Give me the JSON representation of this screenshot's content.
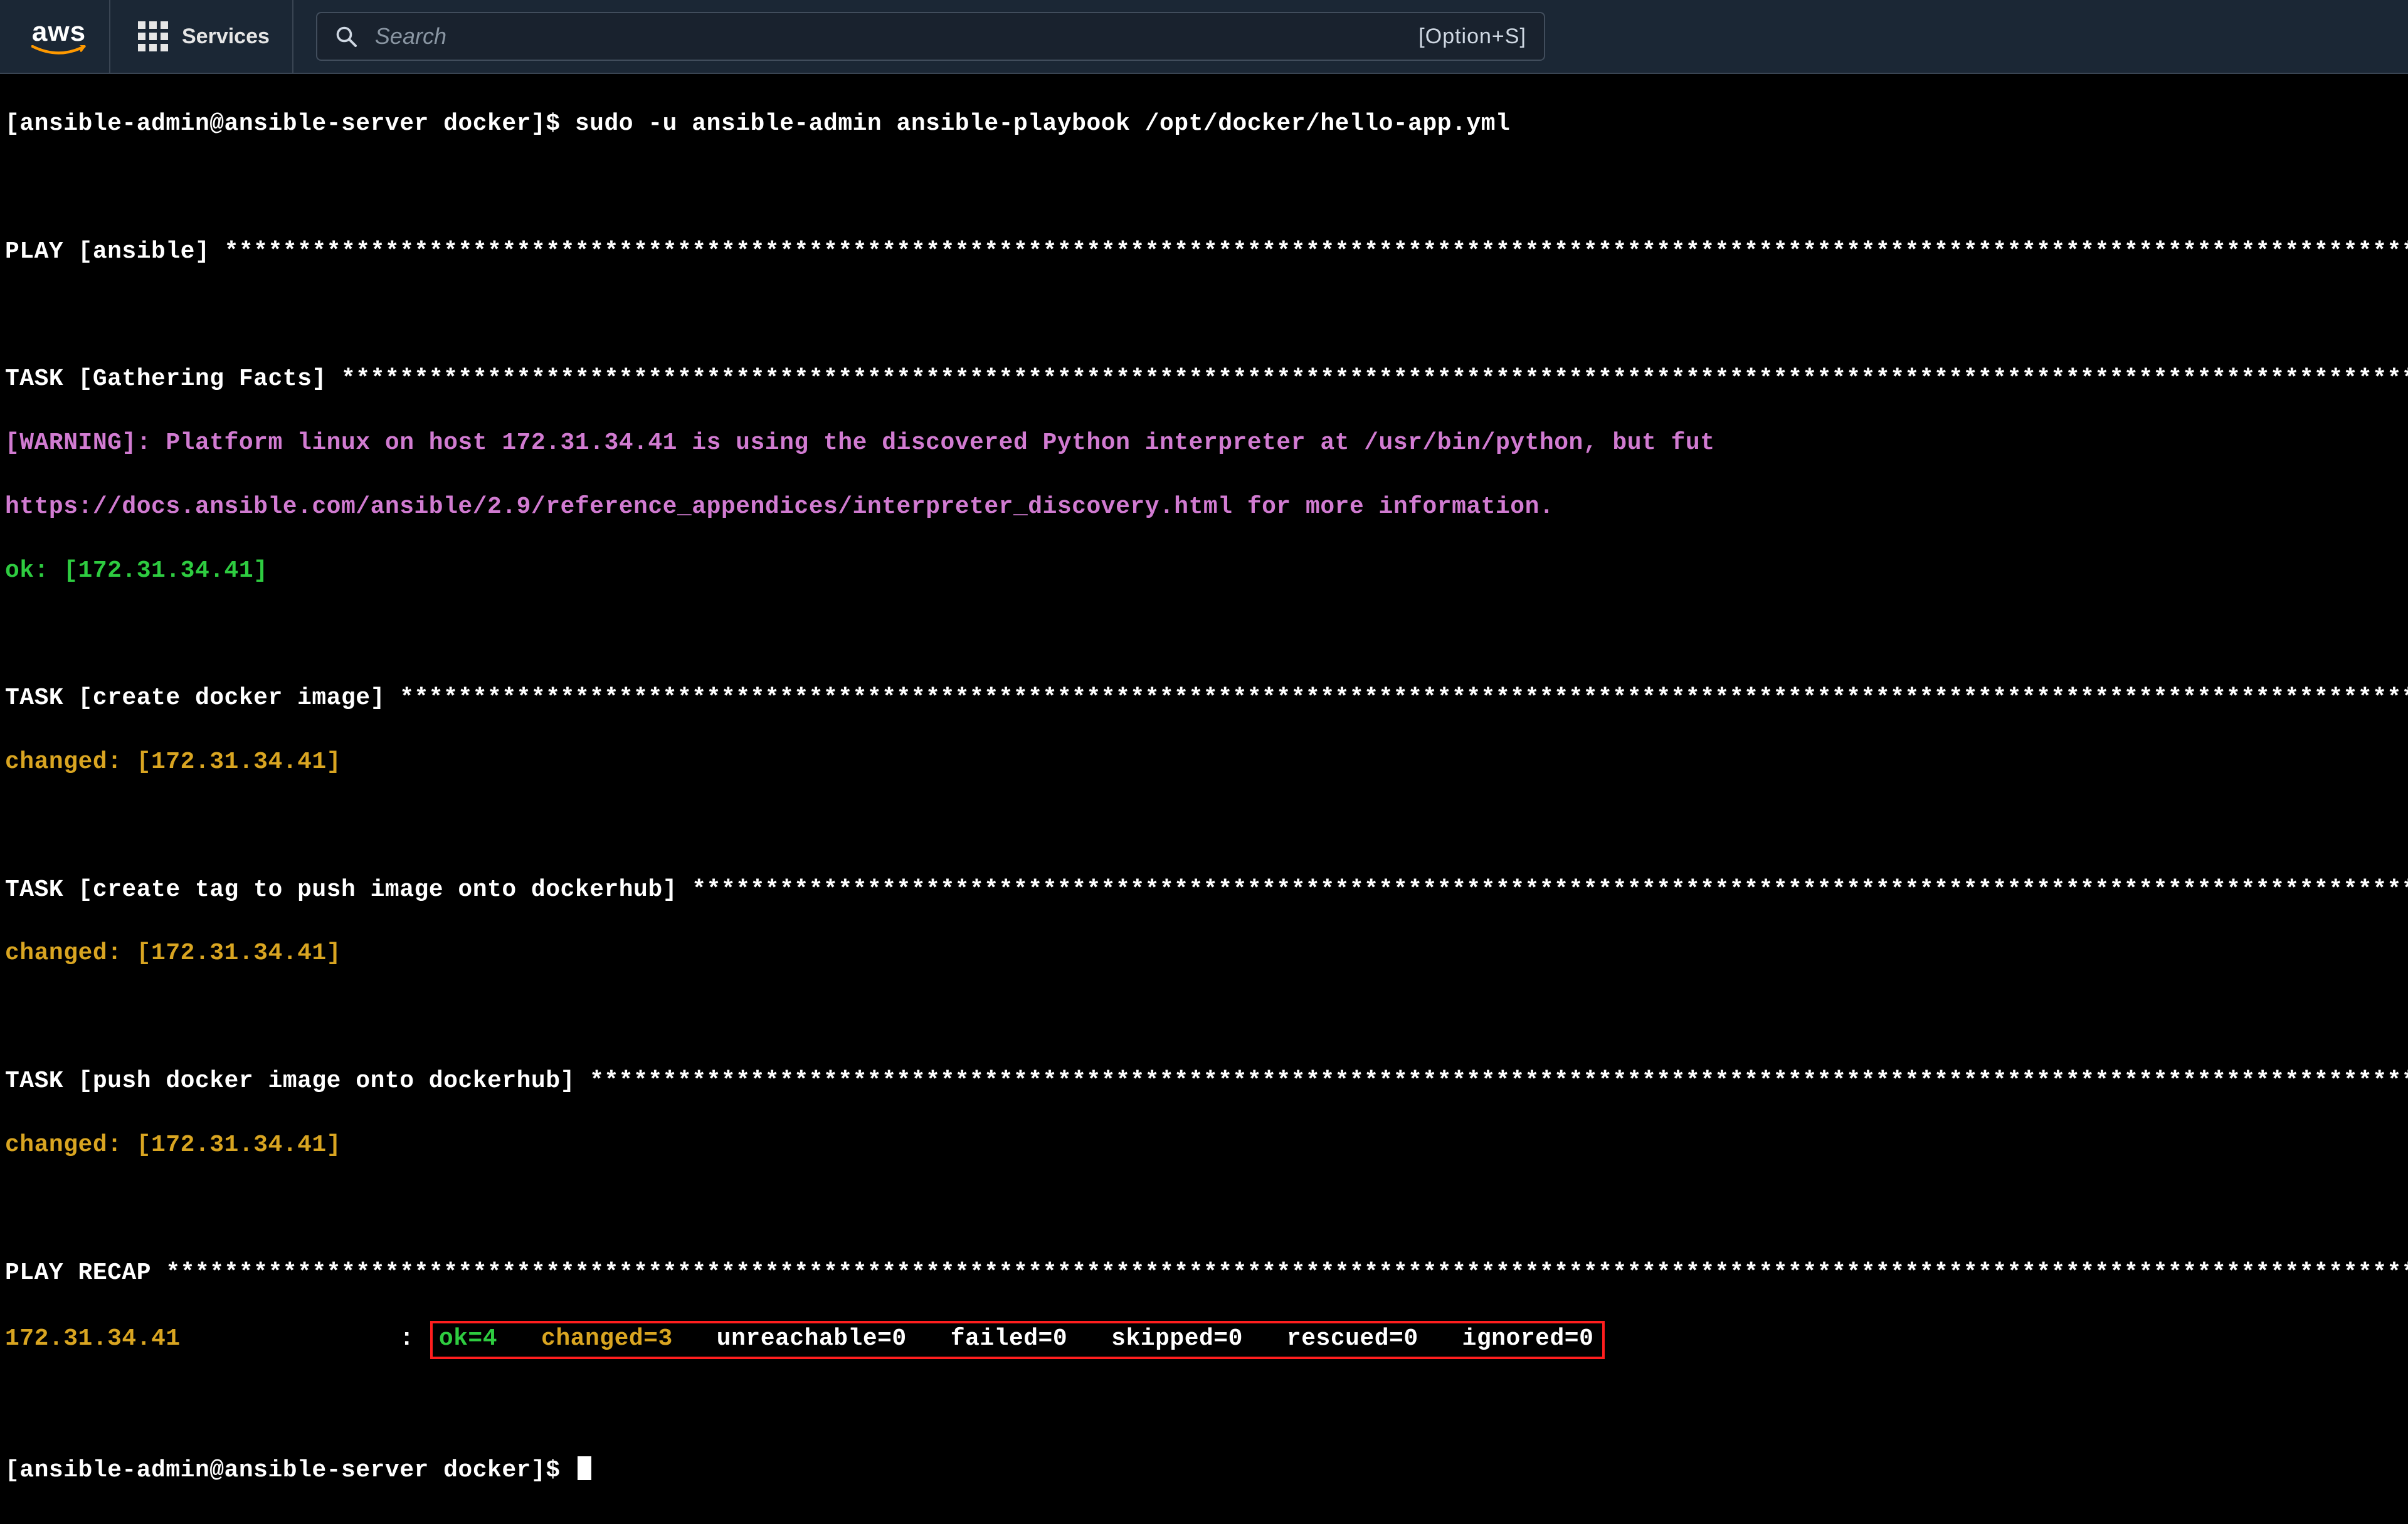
{
  "nav": {
    "logo_text": "aws",
    "services_label": "Services",
    "search_placeholder": "Search",
    "search_shortcut": "[Option+S]"
  },
  "terminal": {
    "prompt_user": "ansible-admin",
    "prompt_host": "ansible-server",
    "prompt_cwd": "docker",
    "prompt_full": "[ansible-admin@ansible-server docker]$ ",
    "command": "sudo -u ansible-admin ansible-playbook /opt/docker/hello-app.yml",
    "play_header_prefix": "PLAY [ansible] ",
    "task_gather_prefix": "TASK [Gathering Facts] ",
    "warning_line1": "[WARNING]: Platform linux on host 172.31.34.41 is using the discovered Python interpreter at /usr/bin/python, but fut",
    "warning_line2": "https://docs.ansible.com/ansible/2.9/reference_appendices/interpreter_discovery.html for more information.",
    "ok_host": "ok: [172.31.34.41]",
    "task_create_image_prefix": "TASK [create docker image] ",
    "changed_host": "changed: [172.31.34.41]",
    "task_tag_prefix": "TASK [create tag to push image onto dockerhub] ",
    "task_push_prefix": "TASK [push docker image onto dockerhub] ",
    "recap_prefix": "PLAY RECAP ",
    "recap_host": "172.31.34.41",
    "recap": {
      "ok": "ok=4",
      "changed": "changed=3",
      "unreachable": "unreachable=0",
      "failed": "failed=0",
      "skipped": "skipped=0",
      "rescued": "rescued=0",
      "ignored": "ignored=0"
    },
    "prompt_full_2": "[ansible-admin@ansible-server docker]$ ",
    "star_fill": "**********************************************************************************************************************************************************************************"
  }
}
